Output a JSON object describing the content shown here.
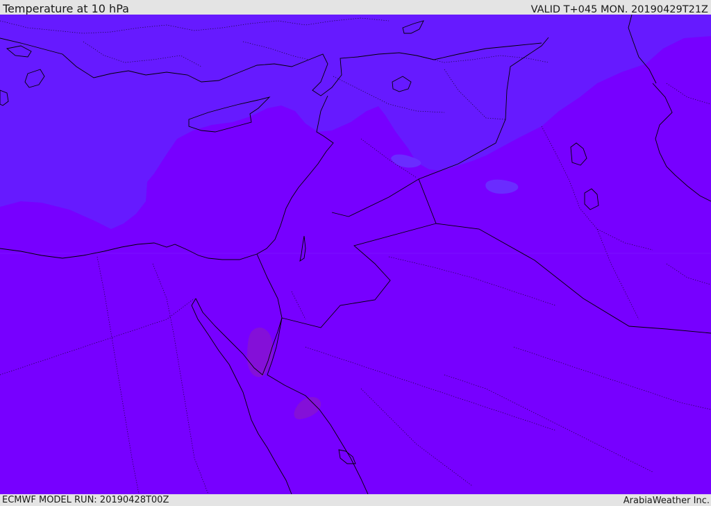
{
  "header": {
    "title": "Temperature at 10 hPa",
    "valid": "VALID T+045 MON. 20190429T21Z"
  },
  "footer": {
    "model_run": "ECMWF MODEL RUN: 20190428T00Z",
    "credit": "ArabiaWeather Inc."
  },
  "map": {
    "colors": {
      "warm_field": "#7700ff",
      "cool_field": "#661aff",
      "cool_patch": "#6a2cff",
      "warm_patch": "#8410d8",
      "coastline": "#000000",
      "background": "#e4e4e4"
    }
  }
}
